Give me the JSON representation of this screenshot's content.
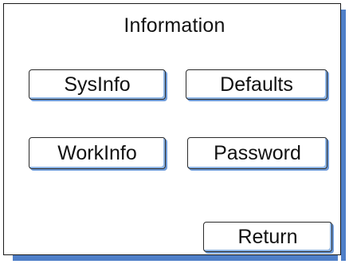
{
  "dialog": {
    "title": "Information"
  },
  "buttons": {
    "sysinfo": "SysInfo",
    "defaults": "Defaults",
    "workinfo": "WorkInfo",
    "password": "Password",
    "return": "Return"
  },
  "colors": {
    "shadow": "#4f7fc8",
    "border": "#1a1a1a",
    "background": "#ffffff"
  }
}
